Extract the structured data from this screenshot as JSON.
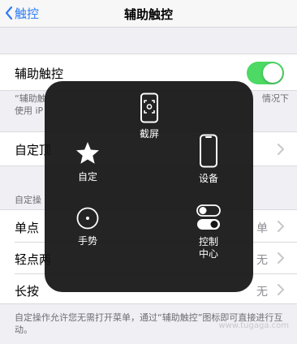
{
  "nav": {
    "back_label": "触控",
    "title": "辅助触控"
  },
  "assistive_touch": {
    "label": "辅助触控",
    "enabled": true
  },
  "toggle_footnote": {
    "line1_left": "“辅助触",
    "line1_right": "情况下",
    "line2": "使用 iP"
  },
  "customize_top": {
    "label": "自定顶"
  },
  "section_header": "自定操",
  "actions": [
    {
      "label": "单点",
      "value": "单"
    },
    {
      "label": "轻点两",
      "value": "无"
    },
    {
      "label": "长按",
      "value": "无"
    }
  ],
  "bottom_footnote": "自定操作允许您无需打开菜单，通过“辅助触控”图标即可直接进行互动。",
  "watermark": "www.tugaga.com",
  "menu": {
    "screenshot": "截屏",
    "custom": "自定",
    "device": "设备",
    "gesture": "手势",
    "control_center_line1": "控制",
    "control_center_line2": "中心"
  },
  "colors": {
    "accent": "#2f7cf6",
    "toggle_on": "#4cd964",
    "menu_bg": "#161616"
  }
}
